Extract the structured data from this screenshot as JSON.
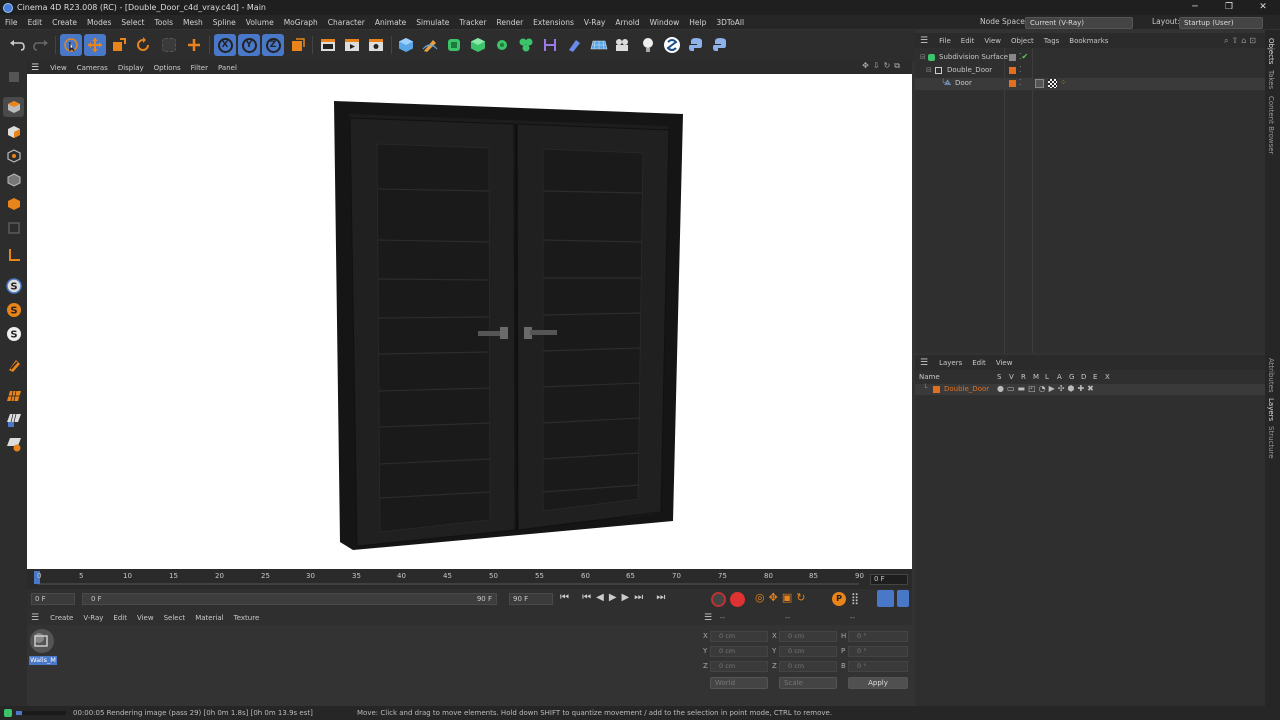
{
  "window": {
    "title": "Cinema 4D R23.008 (RC) - [Double_Door_c4d_vray.c4d] - Main",
    "controls": [
      "─",
      "❐",
      "✕"
    ]
  },
  "menubar": {
    "items": [
      "File",
      "Edit",
      "Create",
      "Modes",
      "Select",
      "Tools",
      "Mesh",
      "Spline",
      "Volume",
      "MoGraph",
      "Character",
      "Animate",
      "Simulate",
      "Tracker",
      "Render",
      "Extensions",
      "V-Ray",
      "Arnold",
      "Window",
      "Help",
      "3DToAll"
    ],
    "node_space_label": "Node Space:",
    "node_space_value": "Current (V-Ray)",
    "layout_label": "Layout:",
    "layout_value": "Startup (User)"
  },
  "toolbar": {
    "axis_x": "X",
    "axis_y": "Y",
    "axis_z": "Z"
  },
  "viewport": {
    "menu": [
      "View",
      "Cameras",
      "Display",
      "Options",
      "Filter",
      "Panel"
    ]
  },
  "timeline": {
    "ticks": [
      "0",
      "5",
      "10",
      "15",
      "20",
      "25",
      "30",
      "35",
      "40",
      "45",
      "50",
      "55",
      "60",
      "65",
      "70",
      "75",
      "80",
      "85",
      "90"
    ],
    "current_frame": "0 F",
    "start_frame": "0 F",
    "range_start": "0 F",
    "range_end": "90 F",
    "end_frame": "90 F"
  },
  "material_manager": {
    "menu": [
      "Create",
      "V-Ray",
      "Edit",
      "View",
      "Select",
      "Material",
      "Texture"
    ],
    "materials": [
      {
        "name": "Walls_M"
      }
    ]
  },
  "coordinates": {
    "header": [
      "--",
      "--",
      "--"
    ],
    "rows": [
      {
        "a": "X",
        "a_val": "0 cm",
        "b": "X",
        "b_val": "0 cm",
        "c": "H",
        "c_val": "0 °"
      },
      {
        "a": "Y",
        "a_val": "0 cm",
        "b": "Y",
        "b_val": "0 cm",
        "c": "P",
        "c_val": "0 °"
      },
      {
        "a": "Z",
        "a_val": "0 cm",
        "b": "Z",
        "b_val": "0 cm",
        "c": "B",
        "c_val": "0 °"
      }
    ],
    "world": "World",
    "scale": "Scale",
    "apply": "Apply"
  },
  "object_manager": {
    "menu": [
      "File",
      "Edit",
      "View",
      "Object",
      "Tags",
      "Bookmarks"
    ],
    "objects": [
      {
        "name": "Subdivision Surface",
        "color": "#9fd6a0"
      },
      {
        "name": "Double_Door",
        "color": "#d0d0d0"
      },
      {
        "name": "Door",
        "color": "#8ec3ff"
      }
    ]
  },
  "layer_manager": {
    "menu": [
      "Layers",
      "Edit",
      "View"
    ],
    "name_header": "Name",
    "flags": [
      "S",
      "V",
      "R",
      "M",
      "L",
      "A",
      "G",
      "D",
      "E",
      "X"
    ],
    "layers": [
      {
        "name": "Double_Door",
        "color": "#e07020"
      }
    ]
  },
  "right_tabs": [
    "Objects",
    "Takes",
    "Content Browser",
    "Attributes",
    "Layers",
    "Structure"
  ],
  "status": {
    "render": "00:00:05 Rendering image (pass 29) [0h  0m  1.8s] [0h  0m 13.9s est]",
    "hint": "Move: Click and drag to move elements. Hold down SHIFT to quantize movement / add to the selection in point mode, CTRL to remove."
  },
  "colors": {
    "accent_orange": "#e8841a",
    "selection_blue": "#4a78c8",
    "door_body": "#1c1c1c"
  }
}
